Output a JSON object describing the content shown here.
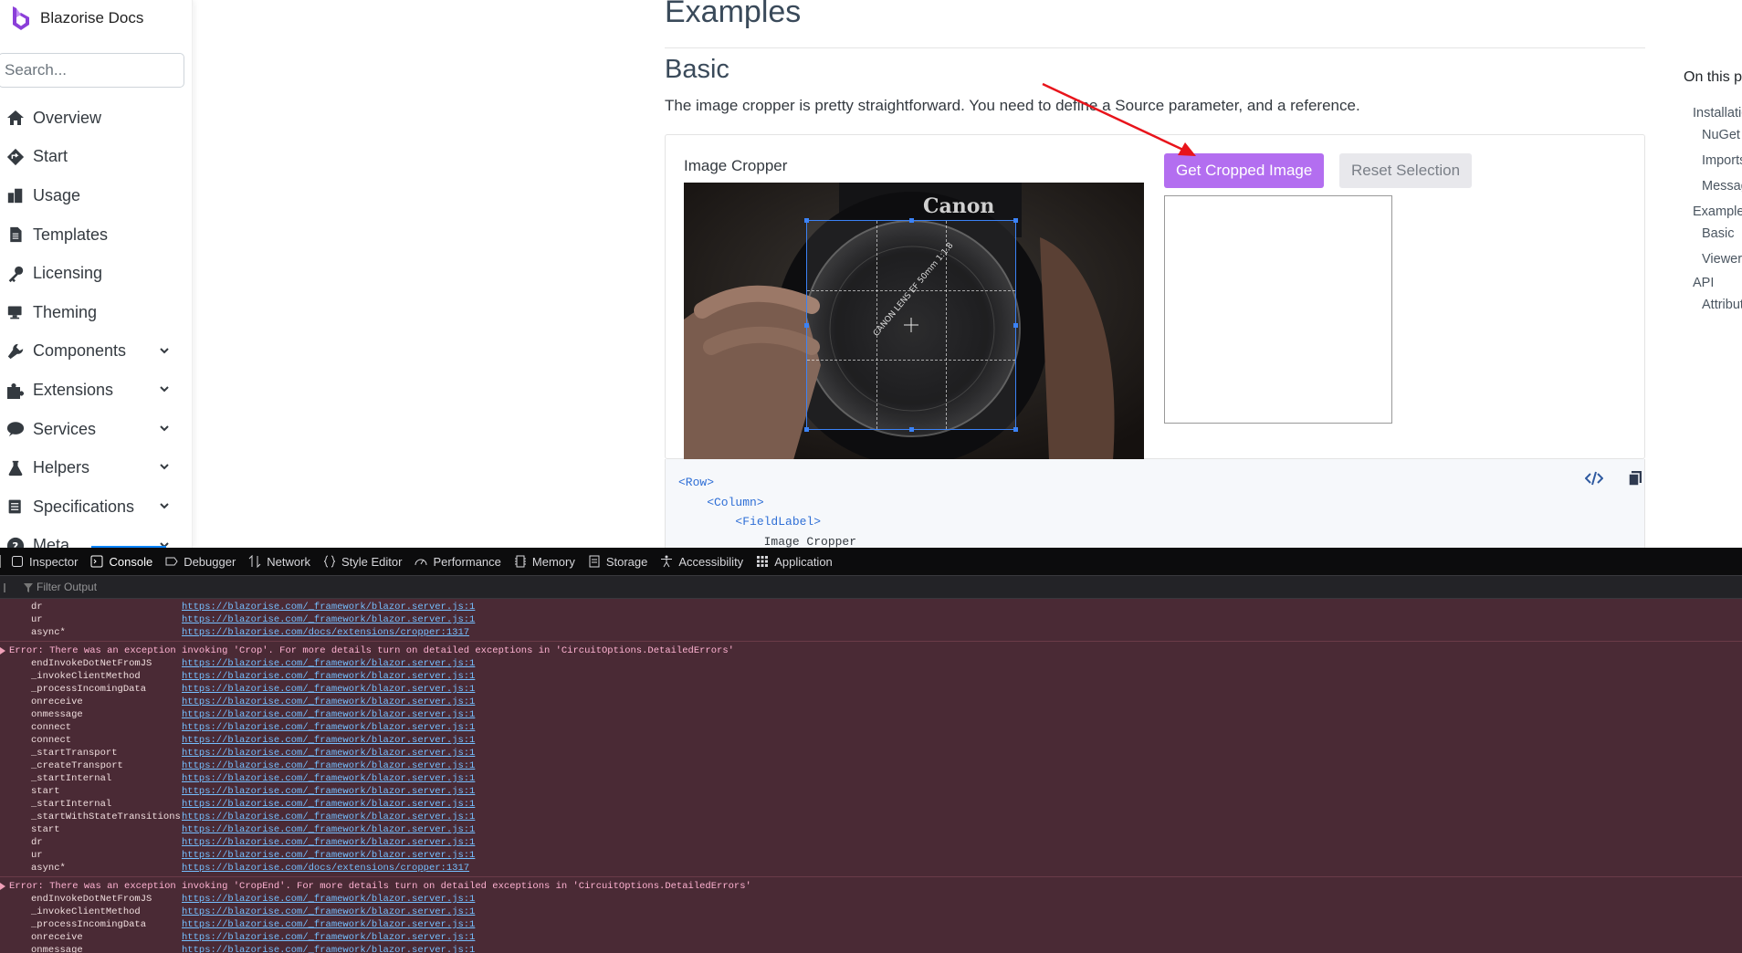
{
  "sidebar": {
    "brand": "Blazorise Docs",
    "search_placeholder": "Search...",
    "items": [
      {
        "label": "Overview",
        "icon": "home-icon"
      },
      {
        "label": "Start",
        "icon": "diamond-arrow-icon"
      },
      {
        "label": "Usage",
        "icon": "book-icon"
      },
      {
        "label": "Templates",
        "icon": "file-icon"
      },
      {
        "label": "Licensing",
        "icon": "key-icon"
      },
      {
        "label": "Theming",
        "icon": "desktop-icon"
      },
      {
        "label": "Components",
        "icon": "wrench-icon",
        "expandable": true
      },
      {
        "label": "Extensions",
        "icon": "puzzle-icon",
        "expandable": true
      },
      {
        "label": "Services",
        "icon": "comment-icon",
        "expandable": true
      },
      {
        "label": "Helpers",
        "icon": "flask-icon",
        "expandable": true
      },
      {
        "label": "Specifications",
        "icon": "list-icon",
        "expandable": true
      },
      {
        "label": "Meta",
        "icon": "question-icon",
        "expandable": true
      }
    ]
  },
  "main": {
    "heading": "Examples",
    "subheading": "Basic",
    "description": "The image cropper is pretty straightforward. You need to define a Source parameter, and a reference.",
    "card": {
      "label": "Image Cropper",
      "get_button": "Get Cropped Image",
      "reset_button": "Reset Selection",
      "image_text": "Canon",
      "lens_text": "CANON LENS EF 50mm 1:1.8"
    },
    "code": [
      "<Row>",
      "    <Column>",
      "        <FieldLabel>",
      "            Image Cropper"
    ]
  },
  "toc": {
    "title": "On this page",
    "items": [
      "Installation",
      "NuGet",
      "Imports",
      "Messages",
      "Examples",
      "Basic",
      "Viewer",
      "API",
      "Attributes"
    ]
  },
  "devtools": {
    "tabs": [
      "Inspector",
      "Console",
      "Debugger",
      "Network",
      "Style Editor",
      "Performance",
      "Memory",
      "Storage",
      "Accessibility",
      "Application"
    ],
    "active_tab": "Console",
    "filter_placeholder": "Filter Output",
    "src_server": "https://blazorise.com/_framework/blazor.server.js:1",
    "src_cropper": "https://blazorise.com/docs/extensions/cropper:1317",
    "lead_frames": [
      {
        "fn": "dr",
        "src": "https://blazorise.com/_framework/blazor.server.js:1"
      },
      {
        "fn": "ur",
        "src": "https://blazorise.com/_framework/blazor.server.js:1"
      },
      {
        "fn": "async*",
        "src": "https://blazorise.com/docs/extensions/cropper:1317"
      }
    ],
    "error1": "Error: There was an exception invoking 'Crop'. For more details turn on detailed exceptions in 'CircuitOptions.DetailedErrors'",
    "error2": "Error: There was an exception invoking 'CropEnd'. For more details turn on detailed exceptions in 'CircuitOptions.DetailedErrors'",
    "frames1": [
      "endInvokeDotNetFromJS",
      "_invokeClientMethod",
      "_processIncomingData",
      "onreceive",
      "onmessage",
      "connect",
      "connect",
      "_startTransport",
      "_createTransport",
      "_startInternal",
      "start",
      "_startInternal",
      "_startWithStateTransitions",
      "start",
      "dr",
      "ur",
      "async*"
    ],
    "frames2": [
      "endInvokeDotNetFromJS",
      "_invokeClientMethod",
      "_processIncomingData",
      "onreceive",
      "onmessage"
    ]
  },
  "colors": {
    "primary_button": "#b36ef0",
    "console_error_bg": "#4a2a35",
    "link": "#75bfff",
    "annotation_arrow": "#e8141b"
  }
}
